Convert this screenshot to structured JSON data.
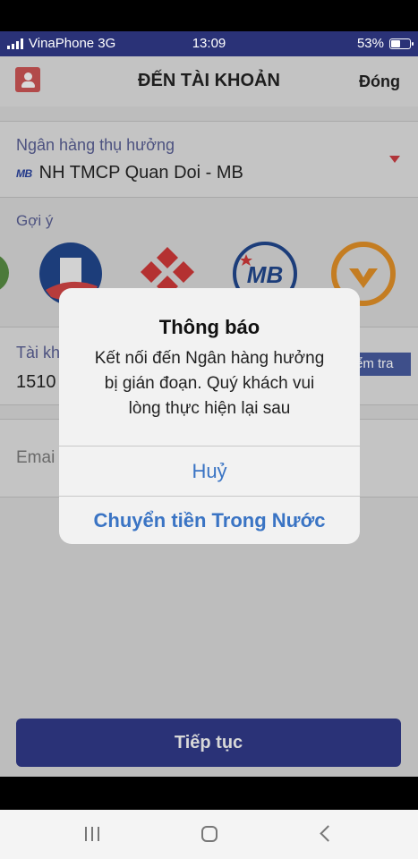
{
  "status_bar": {
    "carrier": "VinaPhone 3G",
    "time": "13:09",
    "battery": "53%",
    "battery_level": 0.53
  },
  "header": {
    "title": "ĐẾN TÀI KHOẢN",
    "close_label": "Đóng",
    "contacts_icon": "contacts-book-icon"
  },
  "bank": {
    "label": "Ngân hàng thụ hưởng",
    "logo_text": "MB",
    "value": "NH TMCP Quan Doi - MB"
  },
  "suggestions": {
    "label": "Gợi ý",
    "logo_text": "MB",
    "icons": [
      "partial-bank-logo-icon",
      "blue-bank-logo-icon",
      "red-diamond-bank-logo-icon",
      "mb-bank-logo-icon",
      "orange-bank-logo-icon"
    ]
  },
  "account": {
    "label": "Tài kh",
    "value": "1510",
    "check_label": "ểm tra"
  },
  "email": {
    "label": "Emai"
  },
  "continue": {
    "label": "Tiếp tục"
  },
  "dialog": {
    "title": "Thông báo",
    "message": "Kết nối đến Ngân hàng hưởng\nbị gián đoạn. Quý khách vui\nlòng thực hiện lại sau",
    "cancel_label": "Huỷ",
    "domestic_label": "Chuyển tiền Trong Nước"
  },
  "colors": {
    "brand": "#2a3277",
    "dialog_button": "#3a74c4",
    "accent_red": "#b0353a"
  }
}
